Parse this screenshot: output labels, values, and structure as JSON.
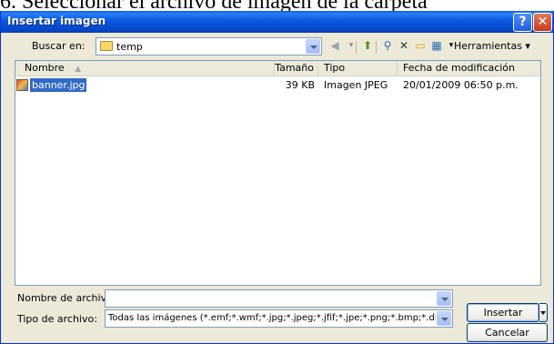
{
  "caption": "6. Seleccionar el archivo de imagen de la carpeta",
  "window": {
    "title": "Insertar imagen",
    "help_glyph": "?",
    "close_glyph": "✕"
  },
  "lookin": {
    "label": "Buscar en:",
    "value": "temp",
    "tools_label": "Herramientas"
  },
  "list": {
    "columns": [
      "Nombre",
      "Tamaño",
      "Tipo",
      "Fecha de modificación"
    ],
    "rows": [
      {
        "name": "banner.jpg",
        "size": "39 KB",
        "type": "Imagen JPEG",
        "modified": "20/01/2009 06:50 p.m."
      }
    ]
  },
  "filename": {
    "label": "Nombre de archivo:",
    "value": ""
  },
  "filetype": {
    "label": "Tipo de archivo:",
    "value": "Todas las imágenes (*.emf;*.wmf;*.jpg;*.jpeg;*.jfif;*.jpe;*.png;*.bmp;*.dib"
  },
  "buttons": {
    "insert": "Insertar",
    "cancel": "Cancelar"
  },
  "colors": {
    "titlebar": "#0a58e0",
    "selection": "#316ac5",
    "dialog_bg": "#ece9d8"
  }
}
